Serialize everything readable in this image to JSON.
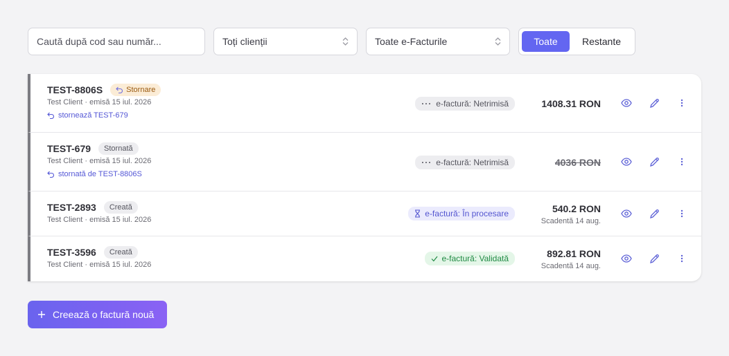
{
  "filters": {
    "search_placeholder": "Caută după cod sau număr...",
    "client_select": "Toți clienții",
    "efactura_select": "Toate e-Facturile",
    "segment": {
      "active": "Toate",
      "inactive": "Restante"
    }
  },
  "invoices": [
    {
      "number": "TEST-8806S",
      "badge": "Stornare",
      "meta": "Test Client · emisă 15 iul. 2026",
      "link": "stornează TEST-679",
      "efactura": "e-factură: Netrimisă",
      "amount": "1408.31 RON"
    },
    {
      "number": "TEST-679",
      "badge": "Stornată",
      "meta": "Test Client · emisă 15 iul. 2026",
      "link": "stornată de TEST-8806S",
      "efactura": "e-factură: Netrimisă",
      "amount": "4036 RON"
    },
    {
      "number": "TEST-2893",
      "badge": "Creată",
      "meta": "Test Client · emisă 15 iul. 2026",
      "efactura": "e-factură: În procesare",
      "amount": "540.2 RON",
      "due": "Scadentă 14 aug."
    },
    {
      "number": "TEST-3596",
      "badge": "Creată",
      "meta": "Test Client · emisă 15 iul. 2026",
      "efactura": "e-factură: Validată",
      "amount": "892.81 RON",
      "due": "Scadentă 14 aug."
    }
  ],
  "create_button": "Creează o factură nouă",
  "colors": {
    "accent": "#6366f1",
    "storno_badge_bg": "#fbecd6",
    "status_gray_bg": "#ededf0",
    "processing_bg": "#ebebfd",
    "validated_bg": "#e4f6e8"
  }
}
